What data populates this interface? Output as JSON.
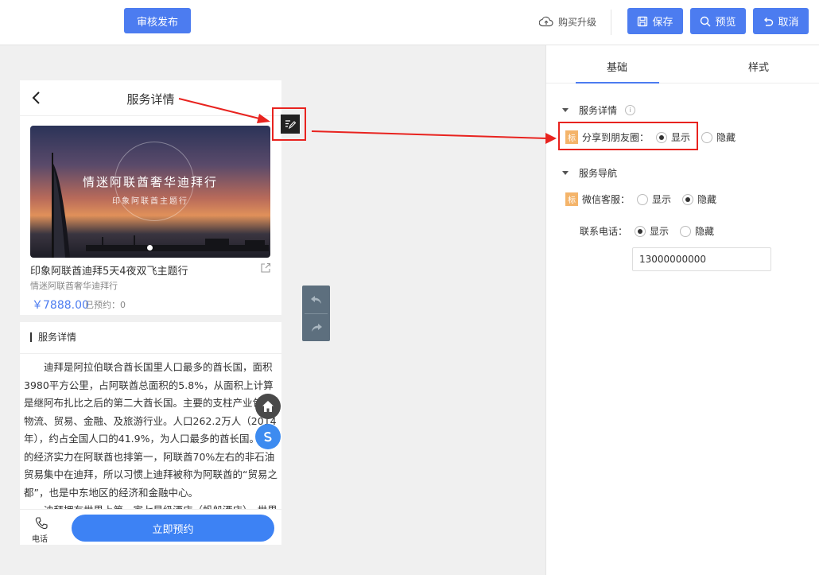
{
  "topbar": {
    "audit_label": "审核发布",
    "upgrade_label": "购买升级",
    "save_label": "保存",
    "preview_label": "预览",
    "cancel_label": "取消"
  },
  "phone": {
    "title": "服务详情",
    "banner_title": "情迷阿联酋奢华迪拜行",
    "banner_subtitle": "印象阿联酋主题行",
    "product_name": "印象阿联酋迪拜5天4夜双飞主题行",
    "product_subtitle": "情迷阿联酋奢华迪拜行",
    "price": "￥7888.00",
    "booked": "已预约：0",
    "section_title": "服务详情",
    "article_p1": "迪拜是阿拉伯联合酋长国里人口最多的酋长国，面积3980平方公里，占阿联酋总面积的5.8%，从面积上计算是继阿布扎比之后的第二大酋长国。主要的支柱产业包括物流、贸易、金融、及旅游行业。人口262.2万人（2014年），约占全国人口的41.9%，为人口最多的酋长国。迪拜的经济实力在阿联酋也排第一，阿联酋70%左右的非石油贸易集中在迪拜，所以习惯上迪拜被称为阿联酋的“贸易之都”，也是中东地区的经济和金融中心。",
    "article_p2": "迪拜拥有世界上第一家七星级酒店（帆船酒店）、世界",
    "call_label": "电话",
    "book_label": "立即预约"
  },
  "panel": {
    "tab_basic": "基础",
    "tab_style": "样式",
    "group1": "服务详情",
    "info_glyph": "i",
    "tag": "标",
    "share_label": "分享到朋友圈：",
    "show": "显示",
    "hide": "隐藏",
    "group2": "服务导航",
    "wechat_label": "微信客服：",
    "phone_label": "联系电话：",
    "phone_value": "13000000000"
  }
}
